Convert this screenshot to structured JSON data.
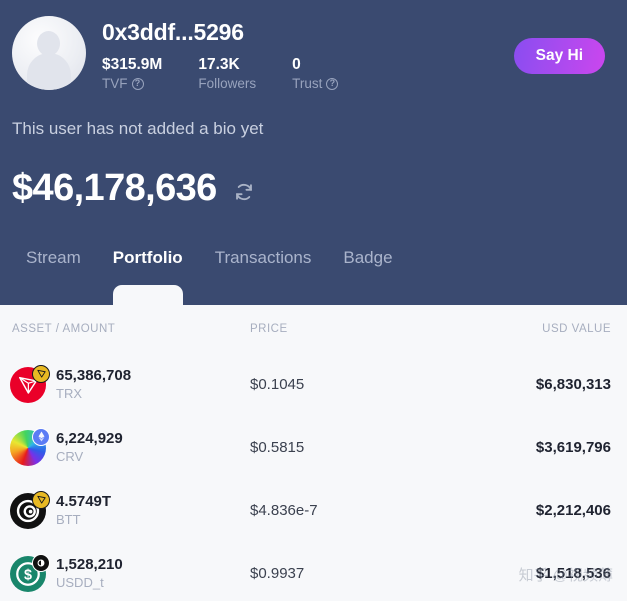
{
  "theme": {
    "hero_bg": "#3a4a70",
    "table_bg": "#f7f8fa",
    "accent_start": "#8a4df0",
    "accent_end": "#cb46ee"
  },
  "profile": {
    "avatar_icon": "default-user-avatar",
    "handle": "0x3ddf...5296",
    "say_hi_label": "Say Hi",
    "bio": "This user has not added a bio yet",
    "total_value": "$46,178,636",
    "refresh_icon": "refresh-icon",
    "stats": [
      {
        "value": "$315.9M",
        "label": "TVF",
        "has_help": true
      },
      {
        "value": "17.3K",
        "label": "Followers",
        "has_help": false
      },
      {
        "value": "0",
        "label": "Trust",
        "has_help": true
      }
    ]
  },
  "tabs": [
    {
      "label": "Stream",
      "active": false
    },
    {
      "label": "Portfolio",
      "active": true
    },
    {
      "label": "Transactions",
      "active": false
    },
    {
      "label": "Badge",
      "active": false
    }
  ],
  "portfolio": {
    "columns": {
      "asset": "ASSET / AMOUNT",
      "price": "PRICE",
      "value": "USD VALUE"
    },
    "rows": [
      {
        "amount": "65,386,708",
        "symbol": "TRX",
        "price": "$0.1045",
        "usd_value": "$6,830,313",
        "icon": "trx-coin-icon",
        "icon_bg": "#ea0029",
        "icon_glyph": "",
        "badge": "tron-network-badge",
        "badge_bg": "#e8b923",
        "badge_glyph": ""
      },
      {
        "amount": "6,224,929",
        "symbol": "CRV",
        "price": "$0.5815",
        "usd_value": "$3,619,796",
        "icon": "crv-coin-icon",
        "icon_bg": "#f0f0f2",
        "icon_glyph": "",
        "badge": "ethereum-network-badge",
        "badge_bg": "#5b7cf5",
        "badge_glyph": "♦"
      },
      {
        "amount": "4.5749T",
        "symbol": "BTT",
        "price": "$4.836e-7",
        "usd_value": "$2,212,406",
        "icon": "btt-coin-icon",
        "icon_bg": "#111111",
        "icon_glyph": "",
        "badge": "tron-network-badge",
        "badge_bg": "#e8b923",
        "badge_glyph": ""
      },
      {
        "amount": "1,528,210",
        "symbol": "USDD_t",
        "price": "$0.9937",
        "usd_value": "$1,518,536",
        "icon": "usdd-coin-icon",
        "icon_bg": "#19866b",
        "icon_glyph": "$",
        "badge": "dark-network-badge",
        "badge_bg": "#111111",
        "badge_glyph": ""
      }
    ]
  },
  "watermark": {
    "text": "知乎 @视频薄"
  }
}
